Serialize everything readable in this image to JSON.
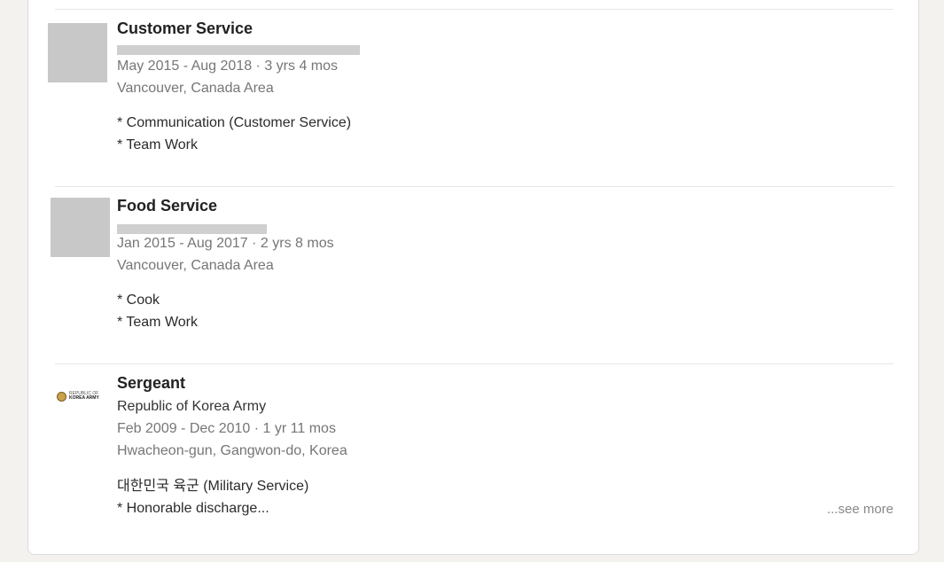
{
  "experience": [
    {
      "title": "Customer Service",
      "dates": "May 2015 - Aug 2018 · 3 yrs 4 mos",
      "location": "Vancouver, Canada Area",
      "description": [
        "* Communication (Customer Service)",
        "* Team Work"
      ]
    },
    {
      "title": "Food Service",
      "dates": "Jan 2015 - Aug 2017 · 2 yrs 8 mos",
      "location": "Vancouver, Canada Area",
      "description": [
        "* Cook",
        "* Team Work"
      ]
    },
    {
      "title": "Sergeant",
      "company": "Republic of Korea Army",
      "logo_text": [
        "REPUBLIC OF",
        "KOREA ARMY"
      ],
      "dates": "Feb 2009 - Dec 2010 · 1 yr 11 mos",
      "location": "Hwacheon-gun, Gangwon-do, Korea",
      "description": [
        "대한민국 육군 (Military Service)",
        "* Honorable discharge..."
      ],
      "see_more": "...see more"
    }
  ],
  "colors": {
    "background": "#f3f2ef",
    "card": "#ffffff",
    "placeholder_logo": "#c8c8c8",
    "seal": "#c9a24a"
  }
}
